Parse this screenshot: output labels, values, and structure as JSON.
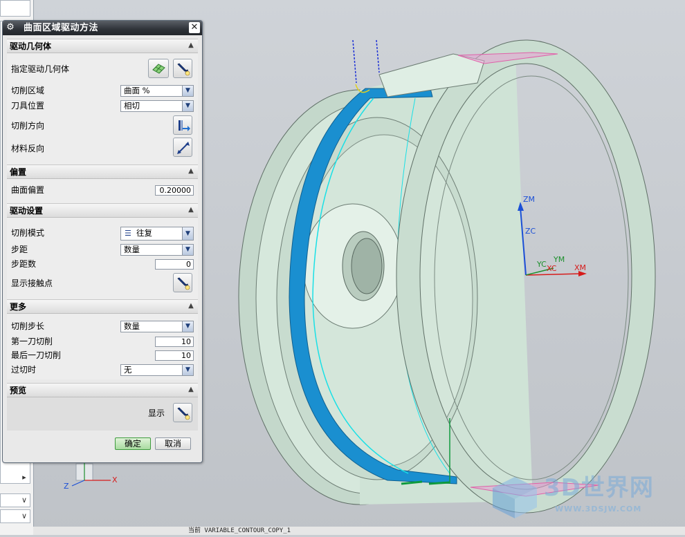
{
  "dialog": {
    "title": "曲面区域驱动方法",
    "groups": {
      "drive_geometry": {
        "header": "驱动几何体",
        "specify_label": "指定驱动几何体",
        "cut_area_label": "切削区域",
        "cut_area_value": "曲面 %",
        "tool_position_label": "刀具位置",
        "tool_position_value": "相切",
        "cut_direction_label": "切削方向",
        "material_reverse_label": "材料反向"
      },
      "offset": {
        "header": "偏置",
        "surface_offset_label": "曲面偏置",
        "surface_offset_value": "0.20000"
      },
      "drive_settings": {
        "header": "驱动设置",
        "cut_pattern_label": "切削模式",
        "cut_pattern_value": "往复",
        "stepover_label": "步距",
        "stepover_value": "数量",
        "stepover_count_label": "步距数",
        "stepover_count_value": "0",
        "show_contact_label": "显示接触点"
      },
      "more": {
        "header": "更多",
        "cut_step_label": "切削步长",
        "cut_step_value": "数量",
        "first_cut_label": "第一刀切削",
        "first_cut_value": "10",
        "last_cut_label": "最后一刀切削",
        "last_cut_value": "10",
        "overcut_label": "过切时",
        "overcut_value": "无"
      },
      "preview": {
        "header": "预览",
        "display_label": "显示"
      }
    },
    "ok_label": "确定",
    "cancel_label": "取消"
  },
  "viewport": {
    "axes": {
      "zm": "ZM",
      "zc": "ZC",
      "yc": "YC",
      "ym": "YM",
      "xc": "XC",
      "xm": "XM"
    },
    "triad": {
      "z": "Z",
      "x": "X"
    }
  },
  "statusbar": {
    "text": "当前 VARIABLE_CONTOUR_COPY_1"
  },
  "watermark": {
    "logo": "3D世界网",
    "url": "WWW.3DSJW.COM"
  },
  "colors": {
    "accent_blue": "#1a8fd0",
    "part_green": "#d8ecdf",
    "dialog_bg": "#e9e9e9",
    "ok_green": "#3d9a3d"
  }
}
